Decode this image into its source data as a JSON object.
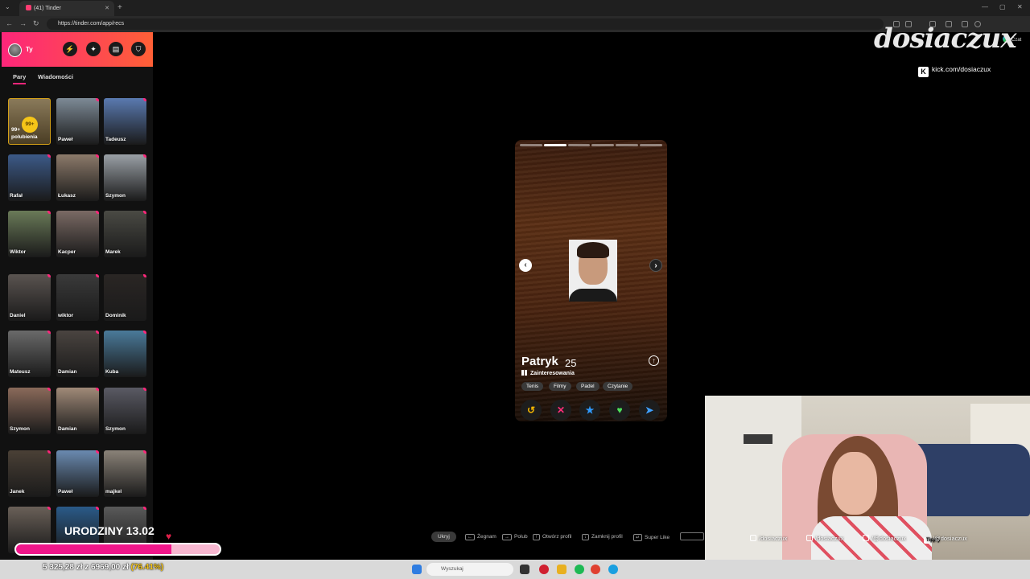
{
  "browser": {
    "tab_title": "(41) Tinder",
    "url": "https://tinder.com/app/recs",
    "copilot_label": "Czat"
  },
  "sidebar": {
    "user_label": "Ty",
    "tabs": [
      {
        "label": "Pary",
        "active": true
      },
      {
        "label": "Wiadomości",
        "active": false
      }
    ],
    "likes": {
      "badge": "99+",
      "text_line1": "99+",
      "text_line2": "polubienia"
    },
    "matches": [
      {
        "name": "Paweł",
        "color": "#7d8a96"
      },
      {
        "name": "Tadeusz",
        "color": "#5a7ab0"
      },
      {
        "name": "Rafał",
        "color": "#3c5a88"
      },
      {
        "name": "Łukasz",
        "color": "#8c7a6a"
      },
      {
        "name": "Szymon",
        "color": "#9aa0a6"
      },
      {
        "name": "Wiktor",
        "color": "#6a7a58"
      },
      {
        "name": "Kacper",
        "color": "#7a6a64"
      },
      {
        "name": "Marek",
        "color": "#4a4a44"
      },
      {
        "name": "Daniel",
        "color": "#5a5450"
      },
      {
        "name": "wiktor",
        "color": "#3a3a3a"
      },
      {
        "name": "Dominik",
        "color": "#2a2624"
      },
      {
        "name": "Mateusz",
        "color": "#6a6a6a"
      },
      {
        "name": "Damian",
        "color": "#4a4440"
      },
      {
        "name": "Kuba",
        "color": "#4a7a9a"
      },
      {
        "name": "Szymon",
        "color": "#8a6a5a"
      },
      {
        "name": "Damian",
        "color": "#a08a78"
      },
      {
        "name": "Szymon",
        "color": "#5a5a64"
      },
      {
        "name": "Janek",
        "color": "#4a4036"
      },
      {
        "name": "Paweł",
        "color": "#6a8ab0"
      },
      {
        "name": "majkel",
        "color": "#8a8278"
      },
      {
        "name": "",
        "color": "#6a6058"
      },
      {
        "name": "",
        "color": "#2a5a88"
      },
      {
        "name": "",
        "color": "#5a5a5a"
      }
    ]
  },
  "watermark": {
    "logo": "dosiaczux",
    "kick_text": "kick.com/dosiaczux"
  },
  "card": {
    "name": "Patryk",
    "age": "25",
    "photo_count": 6,
    "active_photo": 2,
    "interests_label": "Zainteresowania",
    "interests": [
      "Tenis",
      "Filmy",
      "Padel",
      "Czytanie"
    ],
    "actions": [
      {
        "icon": "rewind-icon",
        "glyph": "↺",
        "color": "#f5b700"
      },
      {
        "icon": "nope-icon",
        "glyph": "✕",
        "color": "#fd2e7a"
      },
      {
        "icon": "super-like-icon",
        "glyph": "★",
        "color": "#2f9bff"
      },
      {
        "icon": "like-icon",
        "glyph": "♥",
        "color": "#4ce05a"
      },
      {
        "icon": "boost-icon",
        "glyph": "➤",
        "color": "#3fa0ff"
      }
    ]
  },
  "shortcuts": {
    "hide": "Ukryj",
    "nope": "Żegnam",
    "like": "Polub",
    "open": "Otwórz profil",
    "close": "Zamknij profil",
    "super": "Super Like"
  },
  "webcam": {
    "socials": [
      "/dosiaczux",
      "/dosiaczux",
      "/@dosiaczux",
      "/@dosiaczux"
    ],
    "tipply": "Tipply"
  },
  "goal": {
    "title": "URODZINY 13.02",
    "amount_text": "5 325,28 zł z 6969,00 zł",
    "percent_text": "(76.41%)",
    "progress": 0.7641
  },
  "taskbar": {
    "search_placeholder": "Wyszukaj"
  }
}
